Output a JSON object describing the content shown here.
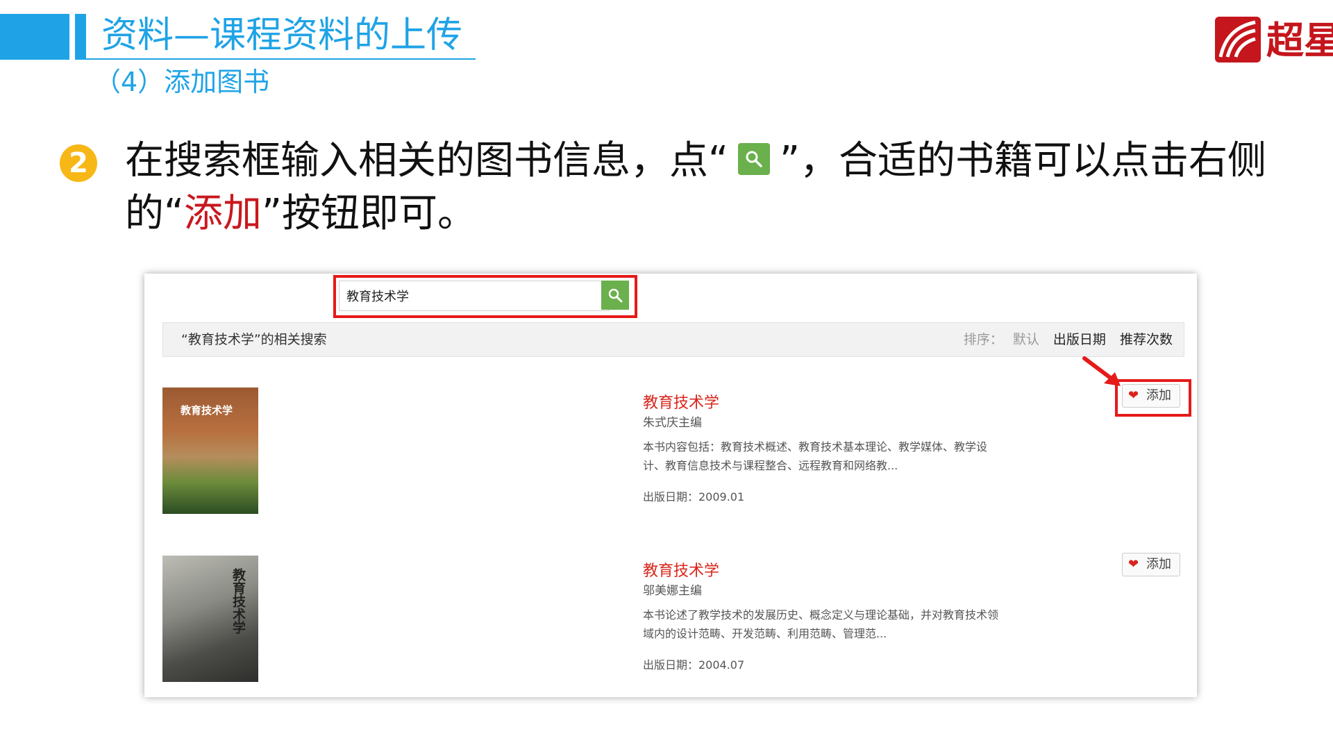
{
  "slide": {
    "title": "资料—课程资料的上传",
    "subtitle": "（4）添加图书",
    "logo_text": "超星",
    "accent_color": "#1fa3e6",
    "logo_color": "#c4161c"
  },
  "instruction": {
    "step_number": "2",
    "part1": "在搜索框输入相关的图书信息，点“",
    "part2": "”，合适的书籍可以点击右侧的“",
    "highlight": "添加",
    "part3": "”按钮即可。",
    "highlight_color": "#c8181e"
  },
  "search": {
    "value": "教育技术学",
    "button_icon": "search-icon",
    "button_color": "#6ab04c"
  },
  "results": {
    "label": "“教育技术学”的相关搜索",
    "sort_label": "排序：",
    "sort_options": [
      "默认",
      "出版日期",
      "推荐次数"
    ]
  },
  "books": [
    {
      "cover_text": "教育技术学",
      "title": "教育技术学",
      "author": "朱式庆主编",
      "description": "本书内容包括：教育技术概述、教育技术基本理论、教学媒体、教学设计、教育信息技术与课程整合、远程教育和网络教...",
      "date": "出版日期：2009.01",
      "add_label": "添加"
    },
    {
      "cover_text": "教育技术学",
      "title": "教育技术学",
      "author": "邬美娜主编",
      "description": "本书论述了教学技术的发展历史、概念定义与理论基础，并对教育技术领域内的设计范畴、开发范畴、利用范畴、管理范...",
      "date": "出版日期：2004.07",
      "add_label": "添加"
    }
  ]
}
